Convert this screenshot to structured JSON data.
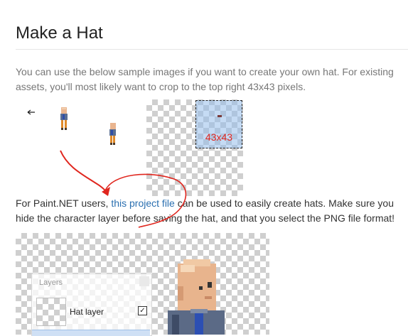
{
  "page": {
    "title": "Make a Hat",
    "intro": "You can use the below sample images if you want to create your own hat. For existing assets, you'll most likely want to crop to the top right 43x43 pixels.",
    "crop_label": "43x43",
    "paintnet_before": "For Paint.NET users, ",
    "paintnet_link": "this project file",
    "paintnet_after": " can be used to easily create hats. Make sure you hide the character layer before saving the hat, and that you select the PNG file format!"
  },
  "layers_panel": {
    "title": "Layers",
    "layer_name": "Hat layer",
    "layer_checked": "✓"
  },
  "colors": {
    "link": "#2a6fb0",
    "annotation": "#e0261e",
    "crop_fill": "#96bee8"
  }
}
